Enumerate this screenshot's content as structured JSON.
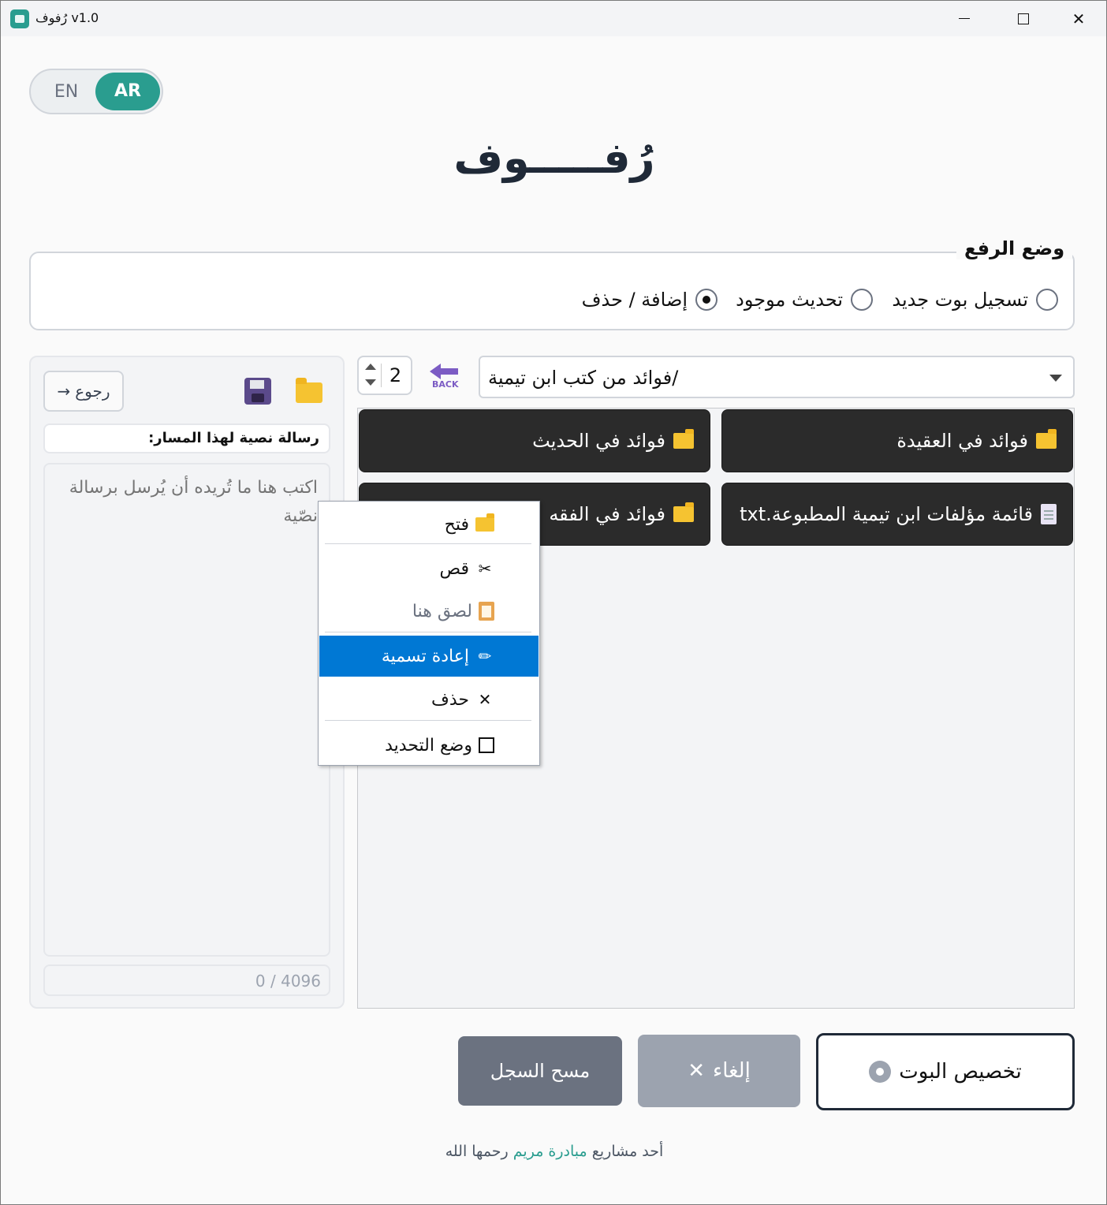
{
  "window": {
    "title": "رُفوف v1.0",
    "minimize": "—",
    "maximize": "□",
    "close": "✕"
  },
  "lang": {
    "en": "EN",
    "ar": "AR",
    "active": "AR"
  },
  "app_title": "رُفـــــوف",
  "upload_mode": {
    "legend": "وضع الرفع",
    "options": [
      {
        "label": "تسجيل بوت جديد",
        "checked": false
      },
      {
        "label": "تحديث موجود",
        "checked": false
      },
      {
        "label": "إضافة / حذف",
        "checked": true
      }
    ]
  },
  "left_panel": {
    "back_label": "رجوع",
    "back_arrow": "→",
    "message_label": "رسالة نصية لهذا المسار:",
    "message_placeholder": "اكتب هنا ما تُريده أن يُرسل برسالة نصّية",
    "counter": "0 / 4096"
  },
  "path_bar": {
    "columns_value": "2",
    "back_text": "BACK",
    "current_path": "/فوائد من كتب ابن تيمية"
  },
  "items": [
    {
      "type": "folder",
      "name": "فوائد في العقيدة"
    },
    {
      "type": "folder",
      "name": "فوائد في الحديث"
    },
    {
      "type": "file",
      "name": "قائمة مؤلفات ابن تيمية المطبوعة.txt"
    },
    {
      "type": "folder",
      "name": "فوائد في الفقه"
    }
  ],
  "context_menu": {
    "open": "فتح",
    "cut": "قص",
    "cut_icon": "✂",
    "paste": "لصق هنا",
    "rename": "إعادة تسمية",
    "rename_icon": "✏",
    "delete": "حذف",
    "delete_icon": "✕",
    "select_mode": "وضع التحديد"
  },
  "buttons": {
    "clear_log": "مسح السجل",
    "cancel": "إلغاء",
    "cancel_icon": "✕",
    "customize": "تخصيص البوت"
  },
  "footer": {
    "prefix": "أحد مشاريع",
    "link": "مبادرة مريم",
    "suffix": "رحمها الله"
  },
  "colors": {
    "accent": "#2a9d8f",
    "tile_bg": "#2b2b2b",
    "menu_highlight": "#0078d4"
  }
}
